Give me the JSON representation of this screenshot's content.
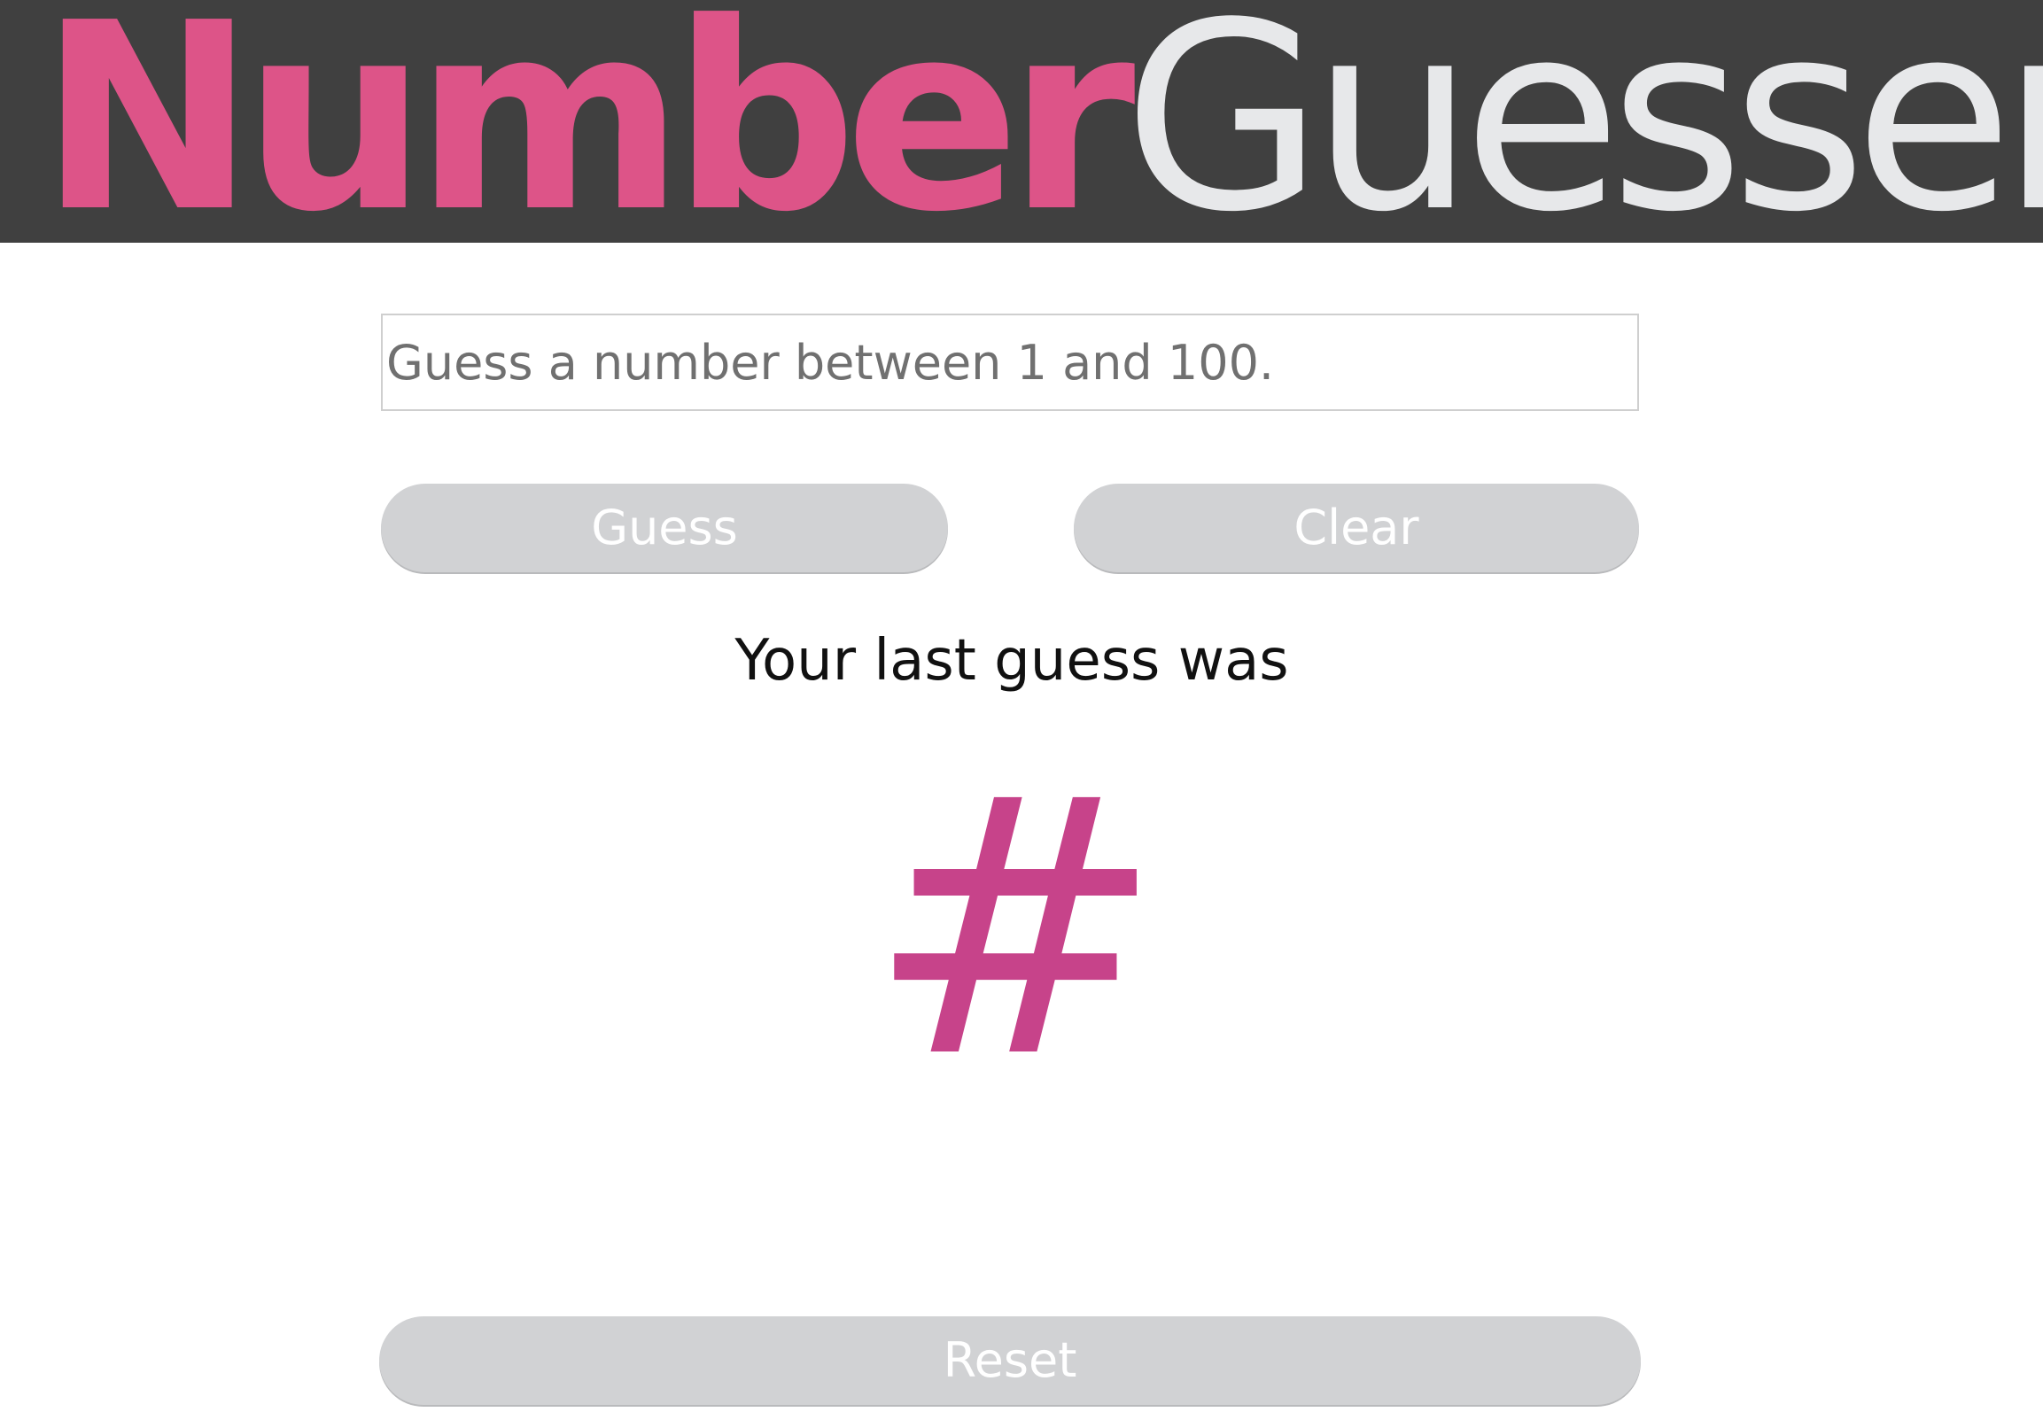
{
  "header": {
    "title_bold": "Number",
    "title_light": "Guesser"
  },
  "colors": {
    "header_background": "#404040",
    "brand_accent": "#dd5488",
    "title_light": "#e7e8ea",
    "guess_value": "#c7438a",
    "button_background": "#d1d2d4",
    "button_text": "#ffffff"
  },
  "form": {
    "input_value": "",
    "input_placeholder": "Guess a number between 1 and 100.",
    "guess_label": "Guess",
    "clear_label": "Clear",
    "reset_label": "Reset"
  },
  "result": {
    "label": "Your last guess was",
    "value": "#"
  }
}
